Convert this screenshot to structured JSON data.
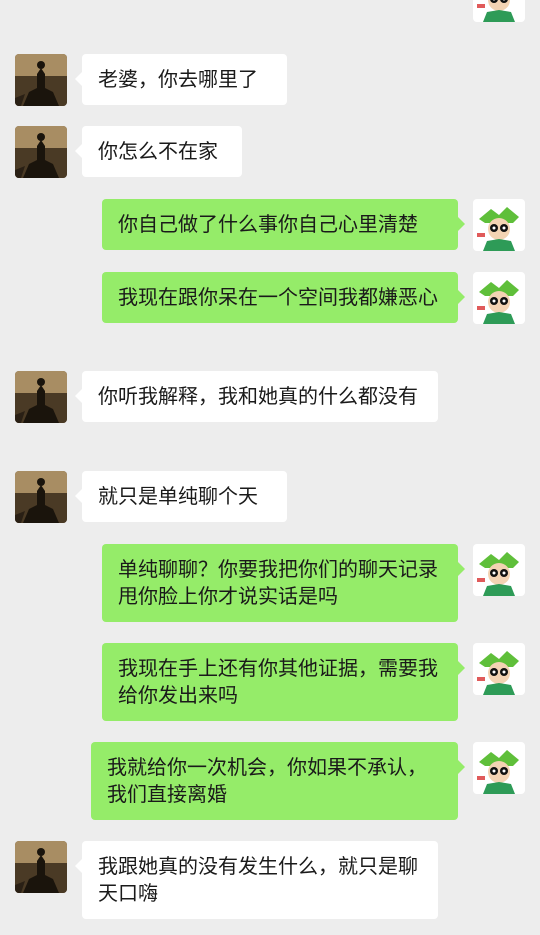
{
  "chat": {
    "messages": [
      {
        "sender": "other",
        "text": "老婆，你去哪里了"
      },
      {
        "sender": "other",
        "text": "你怎么不在家"
      },
      {
        "sender": "self",
        "text": "你自己做了什么事你自己心里清楚"
      },
      {
        "sender": "self",
        "text": "我现在跟你呆在一个空间我都嫌恶心"
      },
      {
        "sender": "other",
        "text": "你听我解释，我和她真的什么都没有"
      },
      {
        "sender": "other",
        "text": "就只是单纯聊个天"
      },
      {
        "sender": "self",
        "text": "单纯聊聊？你要我把你们的聊天记录甩你脸上你才说实话是吗"
      },
      {
        "sender": "self",
        "text": "我现在手上还有你其他证据，需要我给你发出来吗"
      },
      {
        "sender": "self",
        "text": "我就给你一次机会，你如果不承认，我们直接离婚"
      },
      {
        "sender": "other",
        "text": "我跟她真的没有发生什么，就只是聊天口嗨"
      }
    ]
  }
}
